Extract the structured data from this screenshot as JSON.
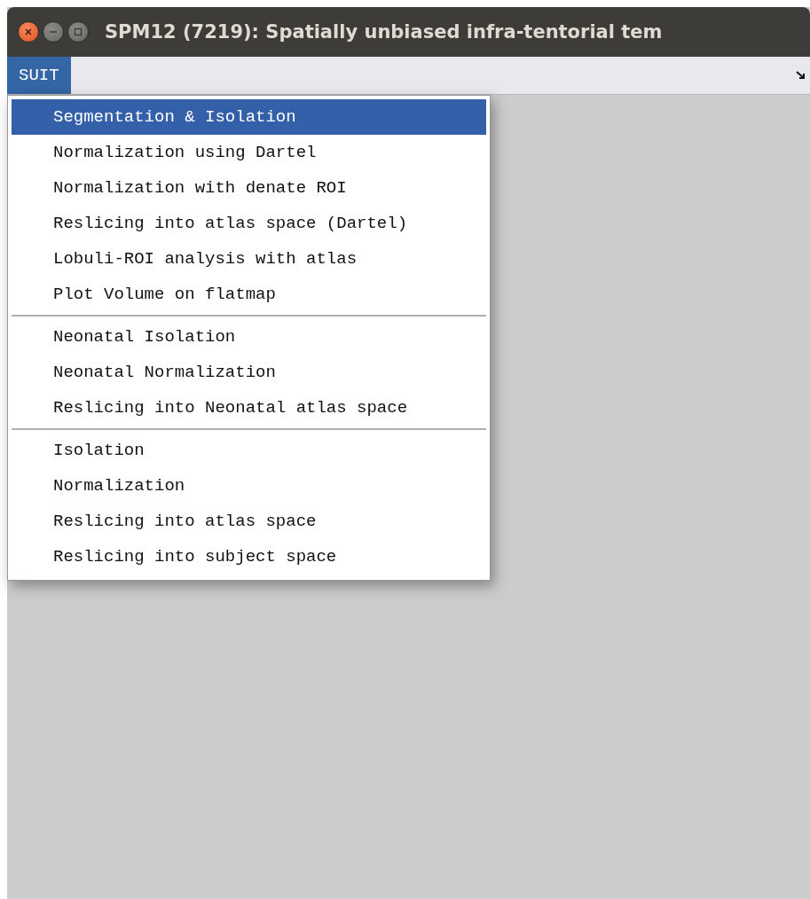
{
  "window": {
    "title": "SPM12 (7219): Spatially unbiased infra-tentorial tem"
  },
  "menubar": {
    "items": [
      {
        "label": "SUIT",
        "selected": true
      }
    ]
  },
  "menu": {
    "sections": [
      {
        "items": [
          {
            "label": "Segmentation & Isolation",
            "selected": true
          },
          {
            "label": "Normalization using Dartel",
            "selected": false
          },
          {
            "label": "Normalization with denate ROI",
            "selected": false
          },
          {
            "label": "Reslicing into atlas space (Dartel)",
            "selected": false
          },
          {
            "label": "Lobuli-ROI analysis with atlas",
            "selected": false
          },
          {
            "label": "Plot Volume on flatmap",
            "selected": false
          }
        ]
      },
      {
        "items": [
          {
            "label": "Neonatal Isolation",
            "selected": false
          },
          {
            "label": "Neonatal Normalization",
            "selected": false
          },
          {
            "label": "Reslicing into Neonatal atlas space",
            "selected": false
          }
        ]
      },
      {
        "items": [
          {
            "label": "Isolation",
            "selected": false
          },
          {
            "label": "Normalization",
            "selected": false
          },
          {
            "label": "Reslicing into atlas space",
            "selected": false
          },
          {
            "label": "Reslicing into subject space",
            "selected": false
          }
        ]
      }
    ]
  }
}
